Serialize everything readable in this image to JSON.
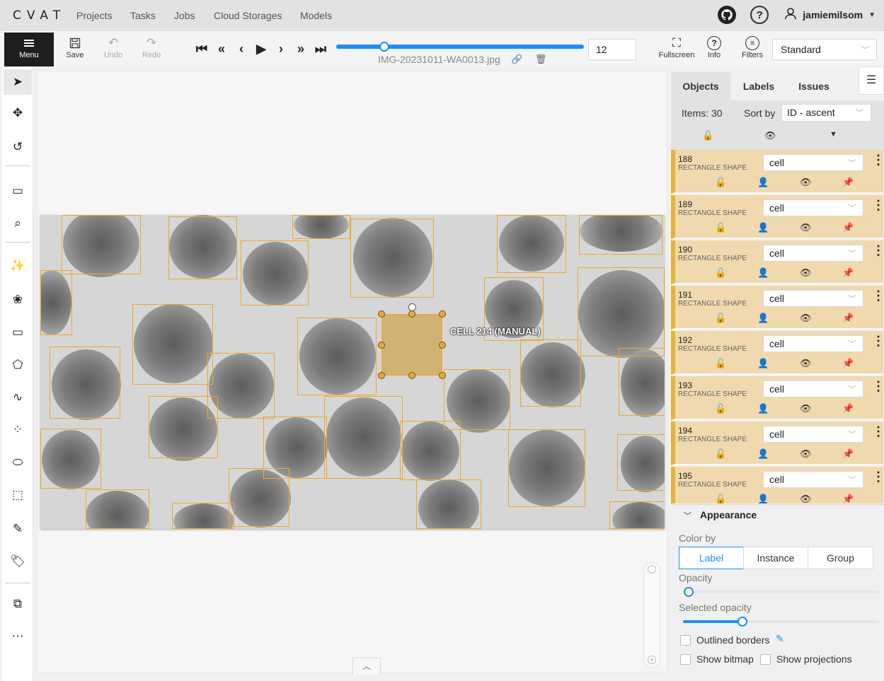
{
  "app": {
    "logo": "CVAT"
  },
  "nav": {
    "projects": "Projects",
    "tasks": "Tasks",
    "jobs": "Jobs",
    "cloud": "Cloud Storages",
    "models": "Models"
  },
  "user": {
    "name": "jamiemilsom"
  },
  "toolbar": {
    "menu": "Menu",
    "save": "Save",
    "undo": "Undo",
    "redo": "Redo",
    "frame": "12",
    "filename": "IMG-20231011-WA0013.jpg",
    "fullscreen": "Fullscreen",
    "info": "Info",
    "filters": "Filters",
    "workspace": "Standard",
    "frame_progress": 0.18
  },
  "canvas": {
    "selected_label": "CELL 214 (MANUAL)"
  },
  "sidebar": {
    "tabs": [
      "Objects",
      "Labels",
      "Issues"
    ],
    "items_count": "Items: 30",
    "sort_by": "Sort by",
    "sort_value": "ID - ascent",
    "objects": [
      {
        "id": "188",
        "type": "RECTANGLE SHAPE",
        "label": "cell"
      },
      {
        "id": "189",
        "type": "RECTANGLE SHAPE",
        "label": "cell"
      },
      {
        "id": "190",
        "type": "RECTANGLE SHAPE",
        "label": "cell"
      },
      {
        "id": "191",
        "type": "RECTANGLE SHAPE",
        "label": "cell"
      },
      {
        "id": "192",
        "type": "RECTANGLE SHAPE",
        "label": "cell"
      },
      {
        "id": "193",
        "type": "RECTANGLE SHAPE",
        "label": "cell"
      },
      {
        "id": "194",
        "type": "RECTANGLE SHAPE",
        "label": "cell"
      },
      {
        "id": "195",
        "type": "RECTANGLE SHAPE",
        "label": "cell"
      }
    ]
  },
  "appearance": {
    "title": "Appearance",
    "color_by": "Color by",
    "color_options": [
      "Label",
      "Instance",
      "Group"
    ],
    "opacity": "Opacity",
    "opacity_value": 0.0,
    "selected_opacity": "Selected opacity",
    "selected_opacity_value": 0.3,
    "outlined": "Outlined borders",
    "show_bitmap": "Show bitmap",
    "show_projections": "Show projections"
  },
  "colors": {
    "accent": "#1890ff",
    "box": "#f5a623",
    "item_bg": "#efd9ad"
  }
}
